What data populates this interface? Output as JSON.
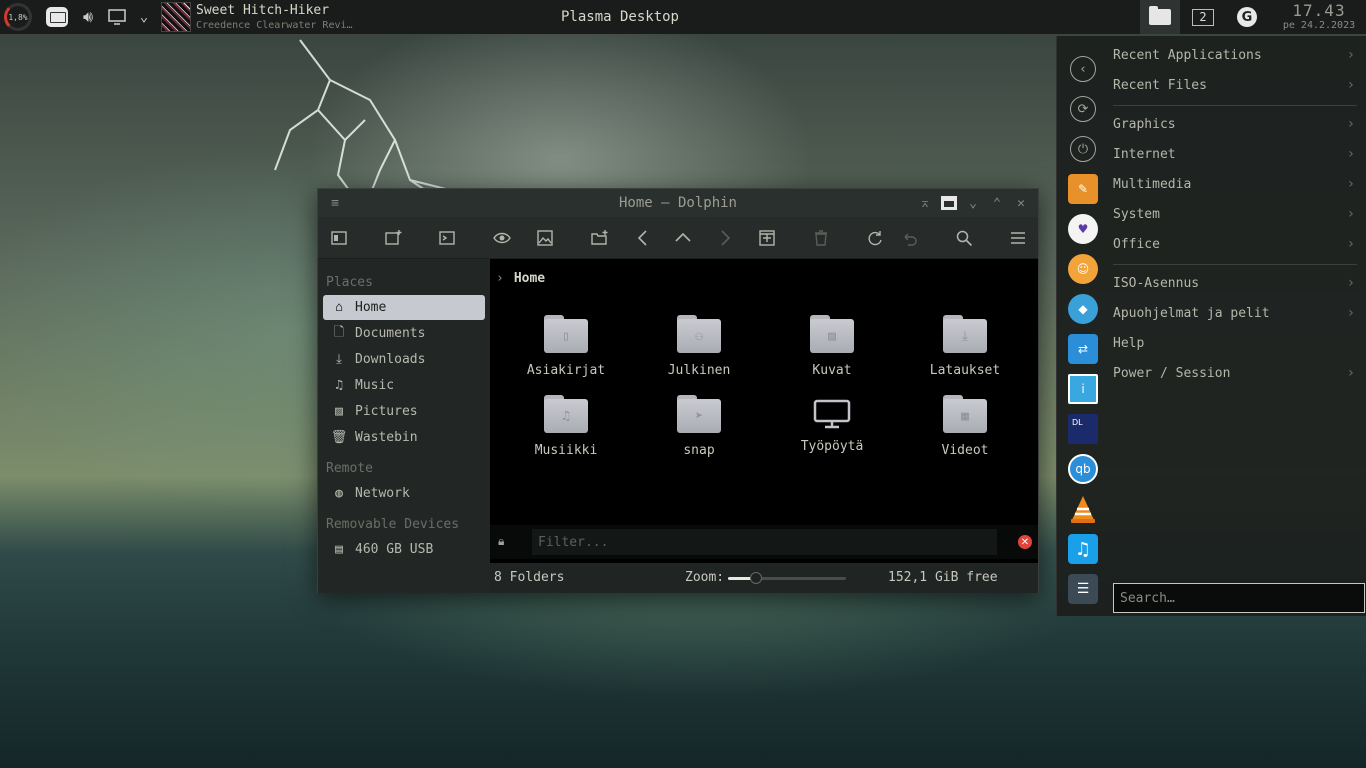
{
  "top_panel": {
    "cpu_load": "1,8%",
    "track_title": "Sweet Hitch-Hiker",
    "track_artist": "Creedence Clearwater Revi…",
    "desktop_title": "Plasma Desktop",
    "pager_number": "2",
    "clock_time": "17.43",
    "clock_date": "pe 24.2.2023"
  },
  "dolphin": {
    "window_title": "Home — Dolphin",
    "places": {
      "section_places": "Places",
      "section_remote": "Remote",
      "section_removable": "Removable Devices",
      "items": [
        {
          "label": "Home",
          "icon": "home-icon"
        },
        {
          "label": "Documents",
          "icon": "documents-icon"
        },
        {
          "label": "Downloads",
          "icon": "downloads-icon"
        },
        {
          "label": "Music",
          "icon": "music-icon"
        },
        {
          "label": "Pictures",
          "icon": "pictures-icon"
        },
        {
          "label": "Wastebin",
          "icon": "wastebin-icon"
        }
      ],
      "remote_items": [
        {
          "label": "Network",
          "icon": "network-icon"
        }
      ],
      "removable_items": [
        {
          "label": "460 GB USB",
          "icon": "usb-drive-icon"
        }
      ]
    },
    "breadcrumb": "Home",
    "folders": [
      {
        "label": "Asiakirjat",
        "icon": "documents-folder-icon"
      },
      {
        "label": "Julkinen",
        "icon": "public-folder-icon"
      },
      {
        "label": "Kuvat",
        "icon": "pictures-folder-icon"
      },
      {
        "label": "Lataukset",
        "icon": "downloads-folder-icon"
      },
      {
        "label": "Musiikki",
        "icon": "music-folder-icon"
      },
      {
        "label": "snap",
        "icon": "snap-folder-icon"
      },
      {
        "label": "Työpöytä",
        "icon": "desktop-monitor-icon"
      },
      {
        "label": "Videot",
        "icon": "videos-folder-icon"
      }
    ],
    "filter_placeholder": "Filter...",
    "status_count": "8 Folders",
    "zoom_label": "Zoom:",
    "zoom_level": 0.2,
    "free_space": "152,1 GiB free"
  },
  "app_menu": {
    "categories_top": [
      "Recent Applications",
      "Recent Files"
    ],
    "categories_mid": [
      "Graphics",
      "Internet",
      "Multimedia",
      "System",
      "Office"
    ],
    "categories_bottom": [
      "ISO-Asennus",
      "Apuohjelmat ja pelit",
      "Help",
      "Power / Session"
    ],
    "search_placeholder": "Search…",
    "dock_icons": [
      "back-icon",
      "refresh-icon",
      "power-icon",
      "app-1-icon",
      "brave-icon",
      "app-3-icon",
      "tag-app-icon",
      "store-app-icon",
      "info-app-icon",
      "terminal-app-icon",
      "qbittorrent-icon",
      "vlc-icon",
      "music-app-icon",
      "settings-app-icon"
    ]
  },
  "colors": {
    "accent_selection": "#c6c9cf",
    "panel_bg": "#1a1c1c",
    "clear_button": "#e0443a"
  }
}
